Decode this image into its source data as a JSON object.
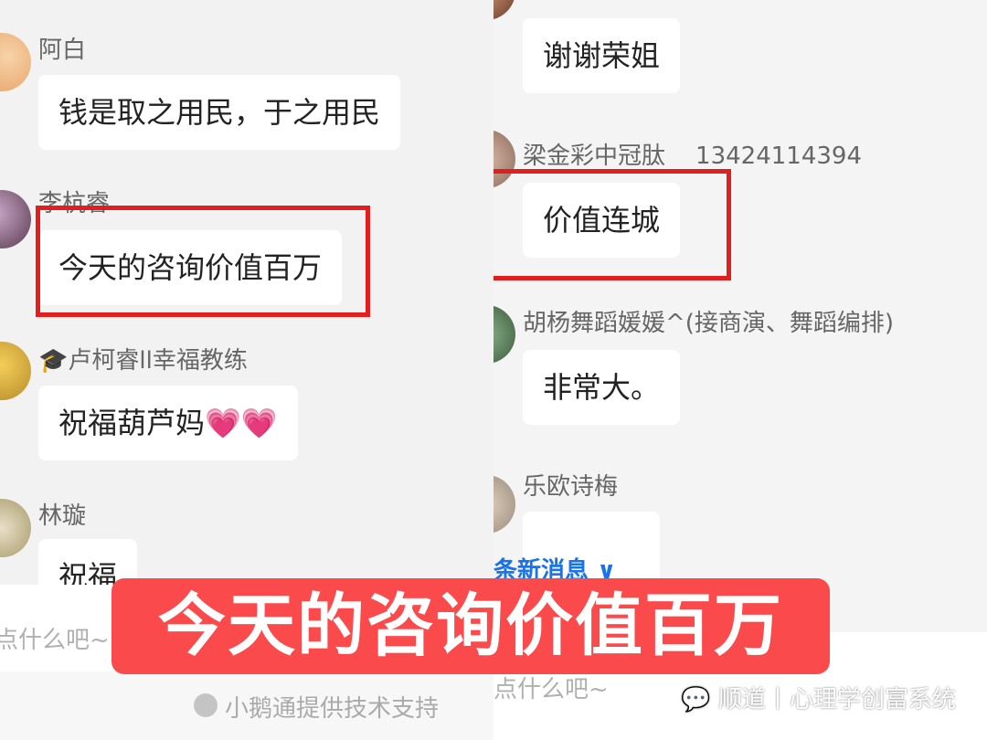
{
  "left_panel": {
    "messages": [
      {
        "name": "阿白",
        "text": "钱是取之用民，于之用民"
      },
      {
        "name": "李杭睿",
        "text": "今天的咨询价值百万"
      },
      {
        "name": "🎓卢柯睿ll幸福教练",
        "text": "祝福葫芦妈💗💗"
      },
      {
        "name": "林璇",
        "text": "祝福"
      }
    ],
    "input_placeholder": "点什么吧~",
    "powered_by": "小鹅通提供技术支持"
  },
  "right_panel": {
    "messages": [
      {
        "name": "",
        "text": "谢谢荣姐"
      },
      {
        "name": "梁金彩中冠肽    13424114394",
        "text": "价值连城"
      },
      {
        "name": "胡杨舞蹈媛媛^(接商演、舞蹈编排)",
        "text": "非常大。"
      },
      {
        "name": "乐欧诗梅",
        "text": ""
      }
    ],
    "new_messages_label": "条新消息",
    "input_placeholder": "点什么吧~"
  },
  "caption": "今天的咨询价值百万",
  "watermark": "顺道丨心理学创富系统",
  "colors": {
    "highlight": "#e11f1f",
    "caption_bg": "#fa4a4b",
    "link_blue": "#1a73e8"
  }
}
